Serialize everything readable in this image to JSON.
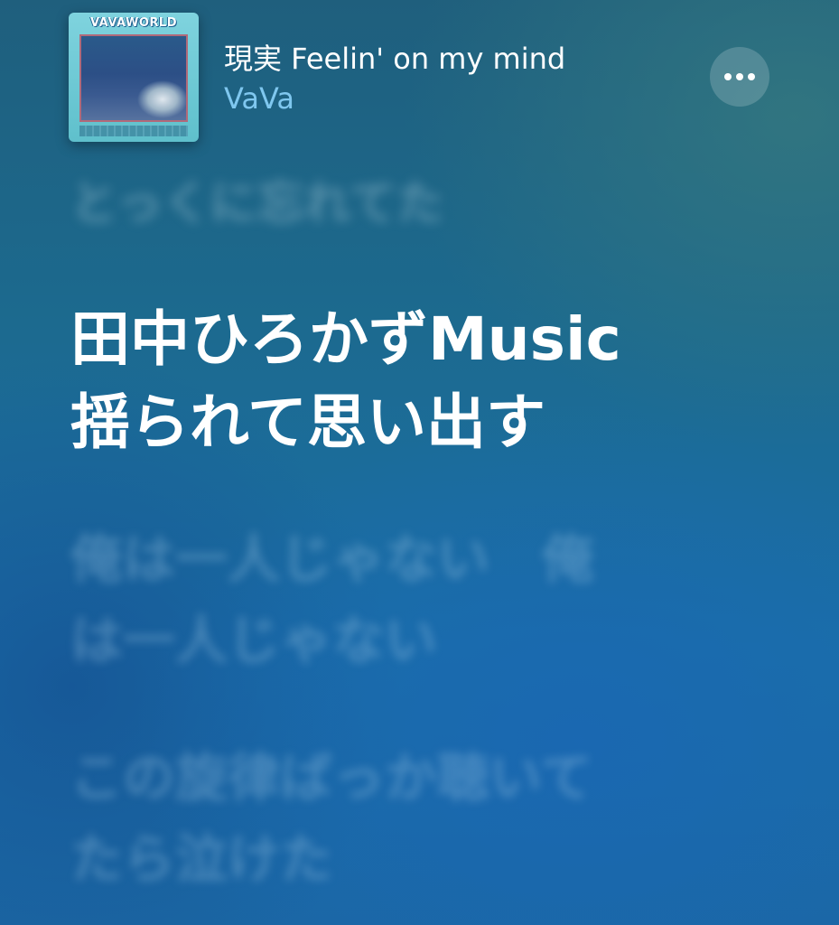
{
  "header": {
    "artwork": {
      "logo_text": "VAVAWORLD",
      "colors": {
        "frame": "#7fd3de",
        "scene": "#2c4f86"
      }
    },
    "song_title": "現実 Feelin' on my mind",
    "artist": "VaVa",
    "more_button_icon": "ellipsis-icon"
  },
  "lyrics": {
    "past": "とっくに忘れてた",
    "current": {
      "line1": "田中ひろかずMusic",
      "line2": "揺られて思い出す"
    },
    "next": [
      {
        "line1": "俺は一人じゃない　俺",
        "line2": "は一人じゃない"
      },
      {
        "line1": "この旋律ばっか聴いて",
        "line2": "たら泣けた"
      }
    ]
  },
  "colors": {
    "title": "#ffffff",
    "artist": "#7fc7ef",
    "active_lyric": "#ffffff",
    "background": "#1a6fa8"
  }
}
